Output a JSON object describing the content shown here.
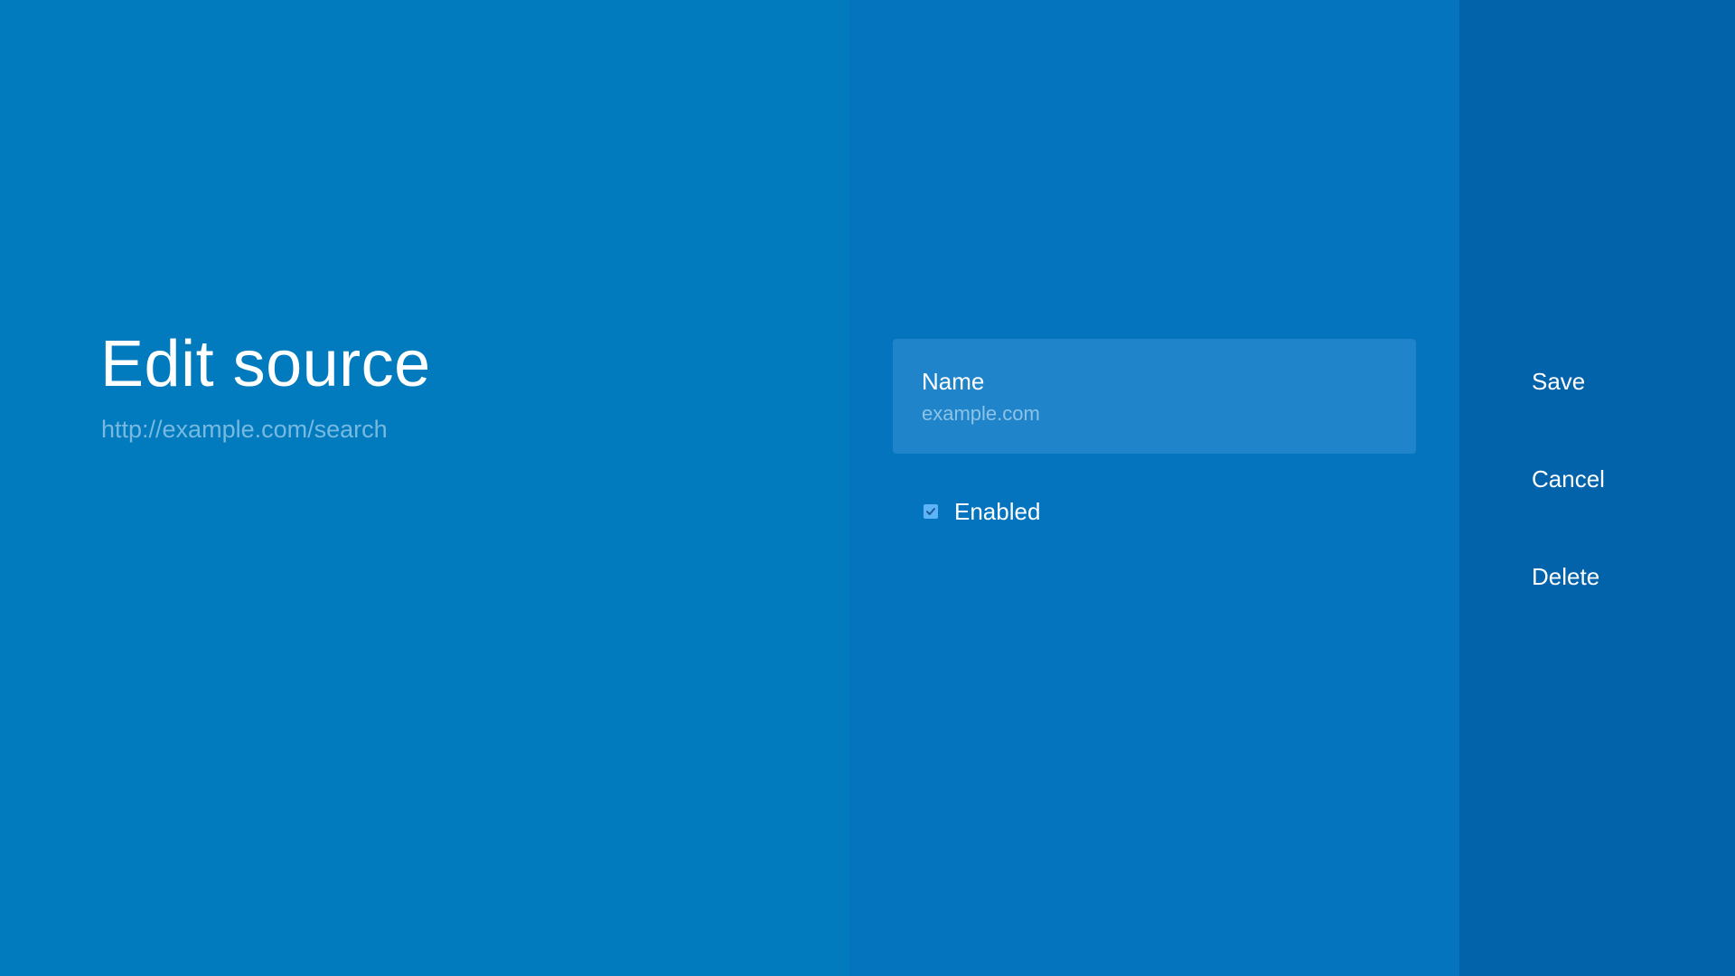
{
  "guidance": {
    "title": "Edit source",
    "subtitle": "http://example.com/search"
  },
  "form": {
    "name_field": {
      "label": "Name",
      "value": "example.com"
    },
    "enabled_checkbox": {
      "label": "Enabled",
      "checked": true
    }
  },
  "actions": {
    "save_label": "Save",
    "cancel_label": "Cancel",
    "delete_label": "Delete"
  },
  "icons": {
    "checkbox": "checkbox-checked-icon"
  },
  "colors": {
    "guidance_background": "#017bbd",
    "actions_background": "#0374bd",
    "buttons_background": "#0263ab",
    "field_background": "#1f84ca",
    "checkbox_accent": "#5cb3f6"
  }
}
